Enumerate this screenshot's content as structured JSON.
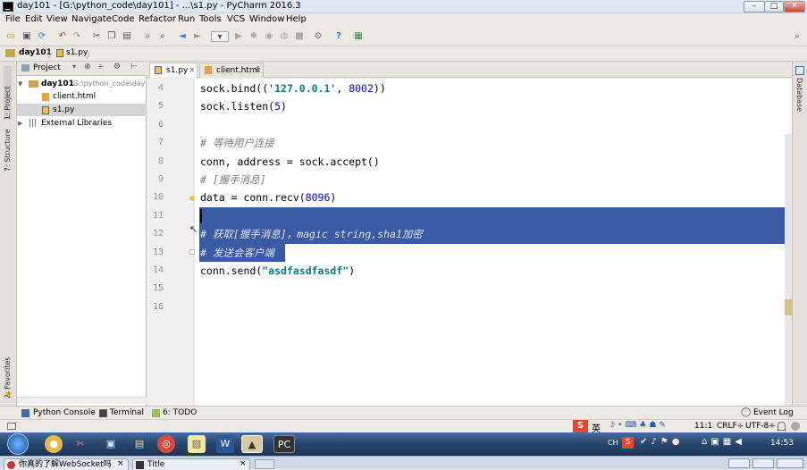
{
  "window": {
    "title": "day101 - [G:\\python_code\\day101] - ...\\s1.py - PyCharm 2016.3",
    "min": "–",
    "max": "□",
    "close": "✕"
  },
  "menu": [
    "File",
    "Edit",
    "View",
    "Navigate",
    "Code",
    "Refactor",
    "Run",
    "Tools",
    "VCS",
    "Window",
    "Help"
  ],
  "breadcrumb": {
    "project": "day101",
    "file": "s1.py"
  },
  "left_tabs": {
    "project": "1: Project",
    "structure": "7: Structure",
    "favorites": "2: Favorites"
  },
  "right_tabs": {
    "database": "Database"
  },
  "project_panel": {
    "header": "Project",
    "root_name": "day101",
    "root_path": "G:\\python_code\\day",
    "files": [
      "client.html",
      "s1.py"
    ],
    "libraries": "External Libraries"
  },
  "editor_tabs": [
    {
      "label": "s1.py",
      "close": "×"
    },
    {
      "label": "client.html",
      "close": "×"
    }
  ],
  "line_numbers": [
    "4",
    "5",
    "6",
    "7",
    "8",
    "9",
    "10",
    "11",
    "12",
    "13",
    "14",
    "15",
    "16"
  ],
  "code": {
    "l4_a": "sock.bind(('",
    "l4_b": "127.0.0.1",
    "l4_c": "', ",
    "l4_d": "8002",
    "l4_e": "))",
    "l5_a": "sock.listen(",
    "l5_b": "5",
    "l5_c": ")",
    "l7": "# 等待用户连接",
    "l8": "conn, address = sock.accept()",
    "l9": "# [握手消息]",
    "l10_a": "data = conn.recv(",
    "l10_b": "8096",
    "l10_c": ")",
    "l12": "# 获取[握手消息]，magic string,sha1加密",
    "l13": "# 发送会客户端",
    "l14_a": "conn.send(",
    "l14_b": "\"asdfasdfasdf\"",
    "l14_c": ")"
  },
  "bottom_tools": {
    "console": "Python Console",
    "terminal": "Terminal",
    "todo": "6: TODO",
    "eventlog": "Event Log"
  },
  "status": {
    "position": "11:1",
    "line_sep": "CRLF÷",
    "encoding": "UTF-8÷",
    "ime": "英"
  },
  "taskbar": {
    "clock": "14:53",
    "lang": "CH"
  },
  "browser_tabs": [
    {
      "label": "你真的了解WebSocket吗",
      "close": "×"
    },
    {
      "label": "Title",
      "close": "×"
    }
  ],
  "colors": {
    "selection": "#3b5aa4",
    "comment": "#808080",
    "string": "#008080",
    "number": "#0000ff"
  }
}
